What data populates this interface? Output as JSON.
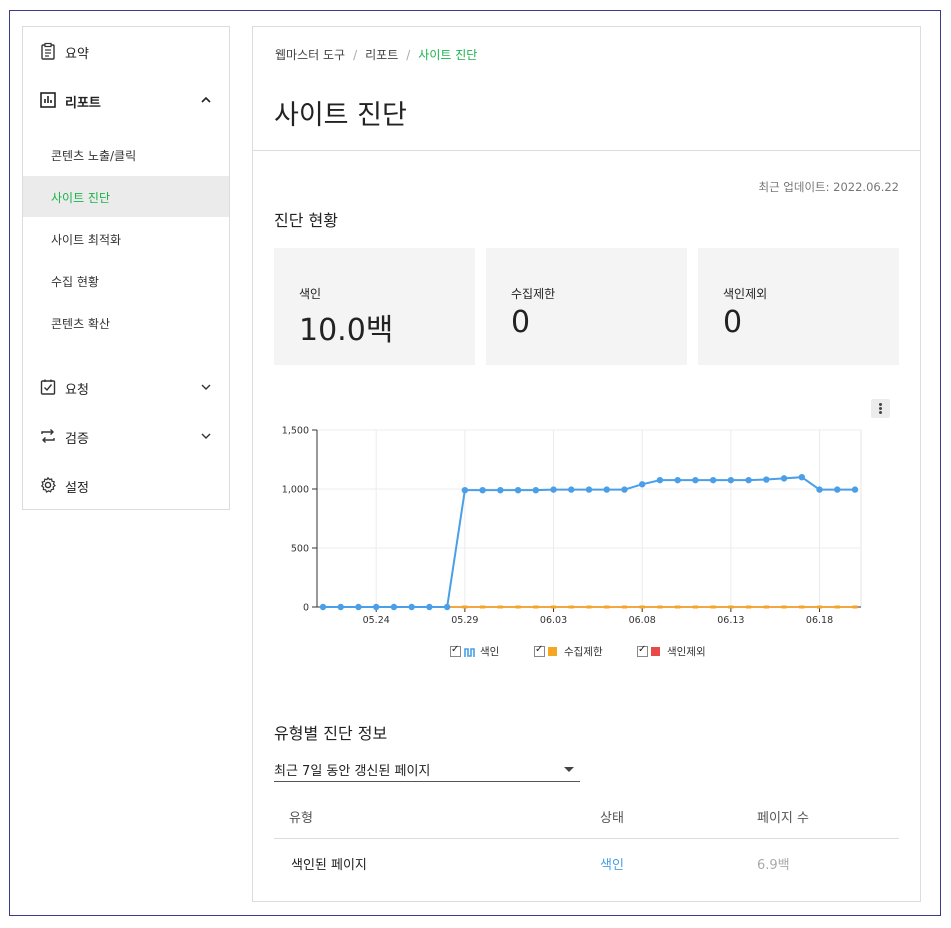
{
  "sidebar": {
    "summary": "요약",
    "report": "리포트",
    "report_sub": [
      "콘텐츠 노출/클릭",
      "사이트 진단",
      "사이트 최적화",
      "수집 현황",
      "콘텐츠 확산"
    ],
    "request": "요청",
    "verify": "검증",
    "settings": "설정"
  },
  "breadcrumb": {
    "root": "웹마스터 도구",
    "mid": "리포트",
    "current": "사이트 진단",
    "sep": "/"
  },
  "page_title": "사이트 진단",
  "updated": "최근 업데이트: 2022.06.22",
  "status_section": "진단 현황",
  "cards": [
    {
      "label": "색인",
      "value": "10.0백"
    },
    {
      "label": "수집제한",
      "value": "0"
    },
    {
      "label": "색인제외",
      "value": "0"
    }
  ],
  "chart_data": {
    "type": "line",
    "x": [
      "05.21",
      "05.22",
      "05.23",
      "05.24",
      "05.25",
      "05.26",
      "05.27",
      "05.28",
      "05.29",
      "05.30",
      "05.31",
      "06.01",
      "06.02",
      "06.03",
      "06.04",
      "06.05",
      "06.06",
      "06.07",
      "06.08",
      "06.09",
      "06.10",
      "06.11",
      "06.12",
      "06.13",
      "06.14",
      "06.15",
      "06.16",
      "06.17",
      "06.18",
      "06.19",
      "06.20"
    ],
    "x_ticks": [
      "05.24",
      "05.29",
      "06.03",
      "06.08",
      "06.13",
      "06.18"
    ],
    "y_ticks": [
      "0",
      "500",
      "1,000",
      "1,500"
    ],
    "ylim": [
      0,
      1500
    ],
    "series": [
      {
        "name": "색인",
        "color": "#4a9fe8",
        "values": [
          0,
          0,
          0,
          0,
          0,
          0,
          0,
          0,
          990,
          990,
          990,
          990,
          990,
          995,
          995,
          995,
          995,
          995,
          1040,
          1075,
          1075,
          1075,
          1075,
          1075,
          1075,
          1080,
          1090,
          1100,
          995,
          995,
          995
        ]
      },
      {
        "name": "수집제한",
        "color": "#f5a623",
        "values": [
          0,
          0,
          0,
          0,
          0,
          0,
          0,
          0,
          0,
          0,
          0,
          0,
          0,
          0,
          0,
          0,
          0,
          0,
          0,
          0,
          0,
          0,
          0,
          0,
          0,
          0,
          0,
          0,
          0,
          0,
          0
        ]
      },
      {
        "name": "색인제외",
        "color": "#e84a4a",
        "values": [
          0,
          0,
          0,
          0,
          0,
          0,
          0,
          0,
          0,
          0,
          0,
          0,
          0,
          0,
          0,
          0,
          0,
          0,
          0,
          0,
          0,
          0,
          0,
          0,
          0,
          0,
          0,
          0,
          0,
          0,
          0
        ]
      }
    ],
    "legend": "bottom"
  },
  "type_section": "유형별 진단 정보",
  "select": {
    "value": "최근 7일 동안 갱신된 페이지"
  },
  "table": {
    "headers": [
      "유형",
      "상태",
      "페이지 수"
    ],
    "rows": [
      {
        "type": "색인된 페이지",
        "status": "색인",
        "pages": "6.9백"
      }
    ]
  },
  "colors": {
    "accent": "#19b34b",
    "link": "#4a9fe8"
  }
}
